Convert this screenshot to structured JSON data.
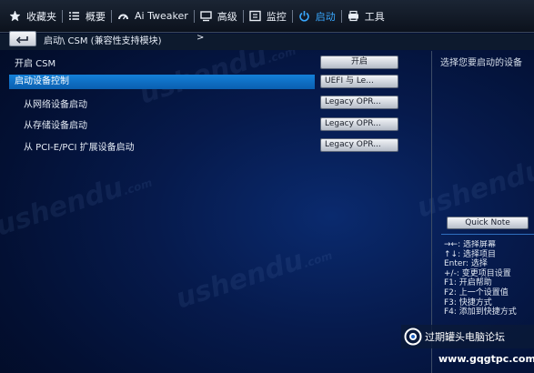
{
  "tabs": [
    {
      "label": "收藏夹",
      "icon": "star-icon",
      "active": false
    },
    {
      "label": "概要",
      "icon": "list-icon",
      "active": false
    },
    {
      "label": "Ai Tweaker",
      "icon": "cloud-gauge-icon",
      "active": false
    },
    {
      "label": "高级",
      "icon": "advanced-settings-icon",
      "active": false
    },
    {
      "label": "监控",
      "icon": "monitor-icon",
      "active": false
    },
    {
      "label": "启动",
      "icon": "power-icon",
      "active": true
    },
    {
      "label": "工具",
      "icon": "printer-tool-icon",
      "active": false
    }
  ],
  "breadcrumb": {
    "path": "启动\\ CSM (兼容性支持模块)",
    "arrow": ">"
  },
  "settings": {
    "csm_label": "开启 CSM",
    "csm_value": "开启",
    "boot_device_control_label": "启动设备控制",
    "boot_device_control_value": "UEFI 与 Le...",
    "network_boot_label": "从网络设备启动",
    "network_boot_value": "Legacy OPR...",
    "storage_boot_label": "从存储设备启动",
    "storage_boot_value": "Legacy OPR...",
    "pcie_boot_label": "从 PCI-E/PCI 扩展设备启动",
    "pcie_boot_value": "Legacy OPR..."
  },
  "help": {
    "title": "选择您要启动的设备",
    "quick_note": "Quick Note",
    "hints": [
      "→←: 选择屏幕",
      "↑↓: 选择项目",
      "Enter: 选择",
      "+/-: 变更项目设置",
      "F1: 开启帮助",
      "F2: 上一个设置值",
      "F3: 快捷方式",
      "F4: 添加到快捷方式"
    ]
  },
  "watermark": {
    "brand": "ushendu",
    "domain": ".com"
  },
  "badge": {
    "title": "过期罐头电脑论坛",
    "url": "www.gqgtpc.com"
  },
  "colors": {
    "accent": "#39a8ff",
    "highlight": "#1480d8",
    "background": "#061a4c"
  }
}
